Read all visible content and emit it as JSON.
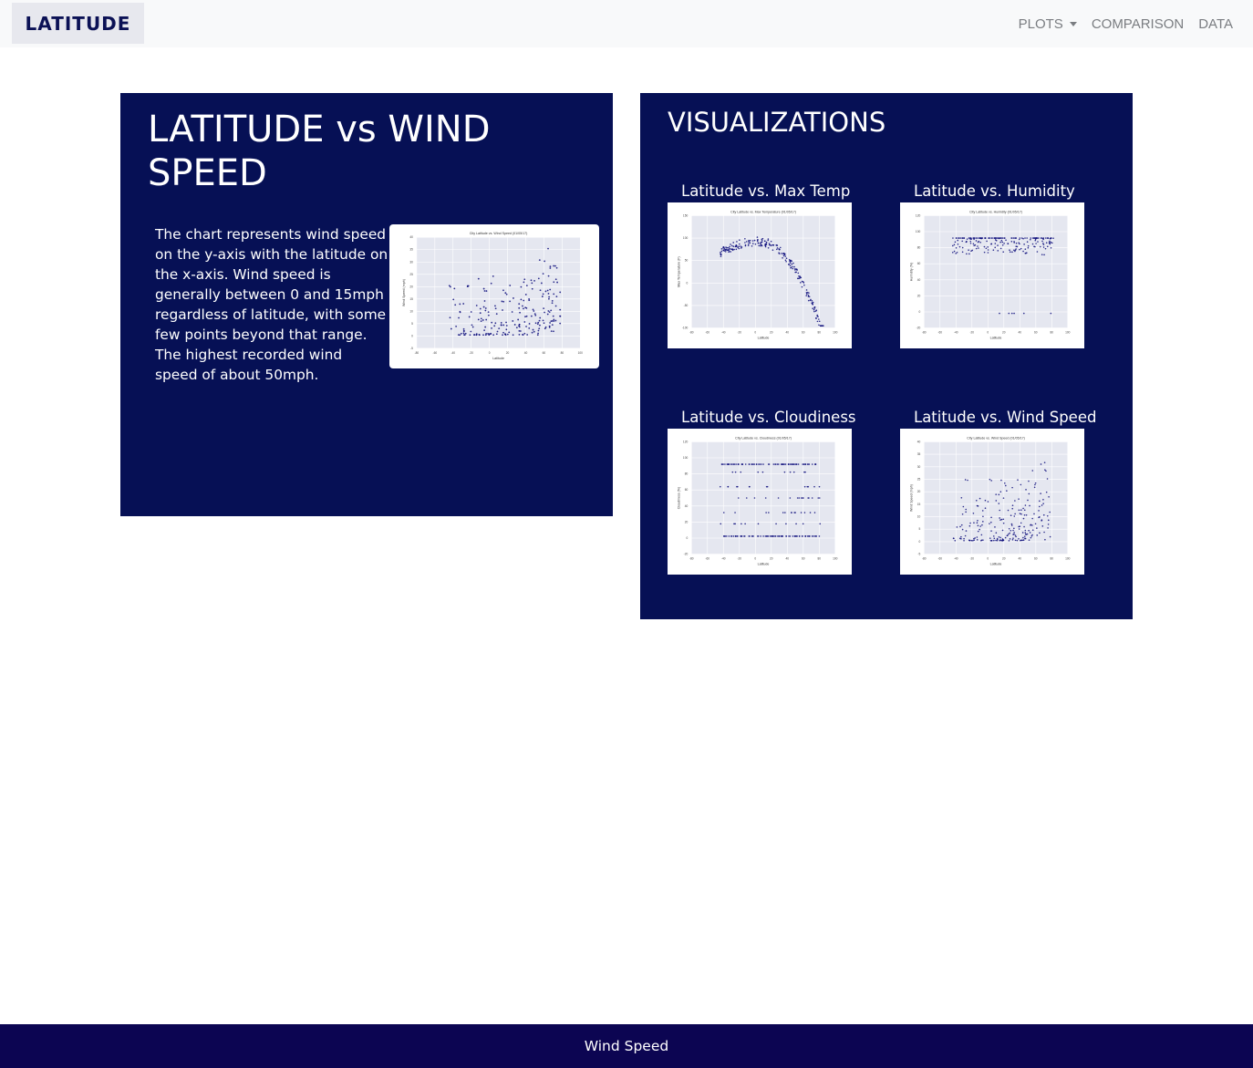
{
  "navbar": {
    "brand": "LATITUDE",
    "links": [
      {
        "label": "PLOTS",
        "dropdown": true
      },
      {
        "label": "COMPARISON",
        "dropdown": false
      },
      {
        "label": "DATA",
        "dropdown": false
      }
    ]
  },
  "main_panel": {
    "title": "LATITUDE vs WIND SPEED",
    "description": "The chart represents wind speed on the y-axis with the latitude on the x-axis. Wind speed is generally between 0 and 15mph regardless of latitude, with some few points beyond that range. The highest recorded wind speed of about 50mph.",
    "chart": {
      "title": "City Latitude vs. Wind Speed (01/05/17)",
      "xlabel": "Latitude",
      "ylabel": "Wind Speed (mph)",
      "xticks": [
        "-80",
        "-60",
        "-40",
        "-20",
        "0",
        "20",
        "40",
        "60",
        "80",
        "100"
      ],
      "yticks": [
        "40",
        "35",
        "30",
        "25",
        "20",
        "15",
        "10",
        "5",
        "0",
        "-5"
      ]
    }
  },
  "visualizations": {
    "title": "VISUALIZATIONS",
    "items": [
      {
        "label": "Latitude vs. Max Temp",
        "chart_title": "City Latitude vs. Max Temperature (01/05/17)",
        "xlabel": "Latitude",
        "ylabel": "Max Temperature (F)",
        "kind": "temp",
        "xticks": [
          "-80",
          "-60",
          "-40",
          "-20",
          "0",
          "20",
          "40",
          "60",
          "80",
          "100"
        ],
        "yticks": [
          "150",
          "100",
          "50",
          "0",
          "-50",
          "-100"
        ]
      },
      {
        "label": "Latitude vs. Humidity",
        "chart_title": "City Latitude vs. Humidity (01/05/17)",
        "xlabel": "Latitude",
        "ylabel": "Humidity (%)",
        "kind": "humidity",
        "xticks": [
          "-80",
          "-60",
          "-40",
          "-20",
          "0",
          "20",
          "40",
          "60",
          "80",
          "100"
        ],
        "yticks": [
          "120",
          "100",
          "80",
          "60",
          "40",
          "20",
          "0",
          "-20"
        ]
      },
      {
        "label": "Latitude vs. Cloudiness",
        "chart_title": "City Latitude vs. Cloudiness (01/05/17)",
        "xlabel": "Latitude",
        "ylabel": "Cloudiness (%)",
        "kind": "cloud",
        "xticks": [
          "-80",
          "-60",
          "-40",
          "-20",
          "0",
          "20",
          "40",
          "60",
          "80",
          "100"
        ],
        "yticks": [
          "120",
          "100",
          "80",
          "60",
          "40",
          "20",
          "0",
          "-20"
        ]
      },
      {
        "label": "Latitude vs. Wind Speed",
        "chart_title": "City Latitude vs. Wind Speed (01/05/17)",
        "xlabel": "Latitude",
        "ylabel": "Wind Speed (mph)",
        "kind": "wind",
        "xticks": [
          "-80",
          "-60",
          "-40",
          "-20",
          "0",
          "20",
          "40",
          "60",
          "80",
          "100"
        ],
        "yticks": [
          "40",
          "35",
          "30",
          "25",
          "20",
          "15",
          "10",
          "5",
          "0",
          "-5"
        ]
      }
    ]
  },
  "footer": {
    "text": "Wind Speed"
  },
  "colors": {
    "navy": "#061055",
    "footer": "#0c0552",
    "point": "#0a0a7a",
    "plot_bg": "#e5e7f0"
  }
}
